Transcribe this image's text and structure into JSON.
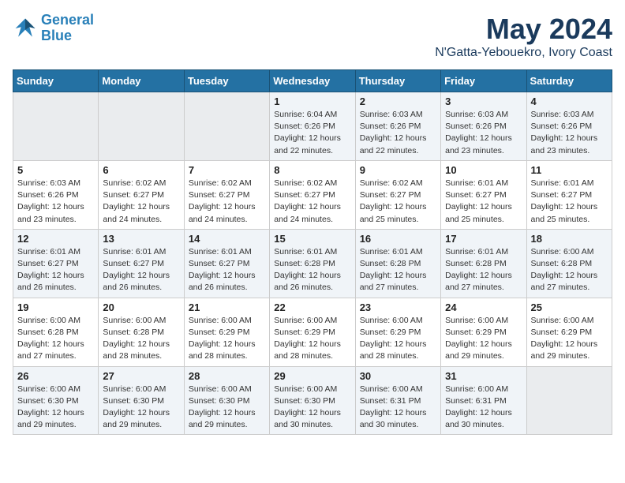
{
  "logo": {
    "line1": "General",
    "line2": "Blue"
  },
  "title": "May 2024",
  "subtitle": "N'Gatta-Yebouekro, Ivory Coast",
  "weekdays": [
    "Sunday",
    "Monday",
    "Tuesday",
    "Wednesday",
    "Thursday",
    "Friday",
    "Saturday"
  ],
  "weeks": [
    [
      {
        "day": "",
        "info": ""
      },
      {
        "day": "",
        "info": ""
      },
      {
        "day": "",
        "info": ""
      },
      {
        "day": "1",
        "info": "Sunrise: 6:04 AM\nSunset: 6:26 PM\nDaylight: 12 hours\nand 22 minutes."
      },
      {
        "day": "2",
        "info": "Sunrise: 6:03 AM\nSunset: 6:26 PM\nDaylight: 12 hours\nand 22 minutes."
      },
      {
        "day": "3",
        "info": "Sunrise: 6:03 AM\nSunset: 6:26 PM\nDaylight: 12 hours\nand 23 minutes."
      },
      {
        "day": "4",
        "info": "Sunrise: 6:03 AM\nSunset: 6:26 PM\nDaylight: 12 hours\nand 23 minutes."
      }
    ],
    [
      {
        "day": "5",
        "info": "Sunrise: 6:03 AM\nSunset: 6:26 PM\nDaylight: 12 hours\nand 23 minutes."
      },
      {
        "day": "6",
        "info": "Sunrise: 6:02 AM\nSunset: 6:27 PM\nDaylight: 12 hours\nand 24 minutes."
      },
      {
        "day": "7",
        "info": "Sunrise: 6:02 AM\nSunset: 6:27 PM\nDaylight: 12 hours\nand 24 minutes."
      },
      {
        "day": "8",
        "info": "Sunrise: 6:02 AM\nSunset: 6:27 PM\nDaylight: 12 hours\nand 24 minutes."
      },
      {
        "day": "9",
        "info": "Sunrise: 6:02 AM\nSunset: 6:27 PM\nDaylight: 12 hours\nand 25 minutes."
      },
      {
        "day": "10",
        "info": "Sunrise: 6:01 AM\nSunset: 6:27 PM\nDaylight: 12 hours\nand 25 minutes."
      },
      {
        "day": "11",
        "info": "Sunrise: 6:01 AM\nSunset: 6:27 PM\nDaylight: 12 hours\nand 25 minutes."
      }
    ],
    [
      {
        "day": "12",
        "info": "Sunrise: 6:01 AM\nSunset: 6:27 PM\nDaylight: 12 hours\nand 26 minutes."
      },
      {
        "day": "13",
        "info": "Sunrise: 6:01 AM\nSunset: 6:27 PM\nDaylight: 12 hours\nand 26 minutes."
      },
      {
        "day": "14",
        "info": "Sunrise: 6:01 AM\nSunset: 6:27 PM\nDaylight: 12 hours\nand 26 minutes."
      },
      {
        "day": "15",
        "info": "Sunrise: 6:01 AM\nSunset: 6:28 PM\nDaylight: 12 hours\nand 26 minutes."
      },
      {
        "day": "16",
        "info": "Sunrise: 6:01 AM\nSunset: 6:28 PM\nDaylight: 12 hours\nand 27 minutes."
      },
      {
        "day": "17",
        "info": "Sunrise: 6:01 AM\nSunset: 6:28 PM\nDaylight: 12 hours\nand 27 minutes."
      },
      {
        "day": "18",
        "info": "Sunrise: 6:00 AM\nSunset: 6:28 PM\nDaylight: 12 hours\nand 27 minutes."
      }
    ],
    [
      {
        "day": "19",
        "info": "Sunrise: 6:00 AM\nSunset: 6:28 PM\nDaylight: 12 hours\nand 27 minutes."
      },
      {
        "day": "20",
        "info": "Sunrise: 6:00 AM\nSunset: 6:28 PM\nDaylight: 12 hours\nand 28 minutes."
      },
      {
        "day": "21",
        "info": "Sunrise: 6:00 AM\nSunset: 6:29 PM\nDaylight: 12 hours\nand 28 minutes."
      },
      {
        "day": "22",
        "info": "Sunrise: 6:00 AM\nSunset: 6:29 PM\nDaylight: 12 hours\nand 28 minutes."
      },
      {
        "day": "23",
        "info": "Sunrise: 6:00 AM\nSunset: 6:29 PM\nDaylight: 12 hours\nand 28 minutes."
      },
      {
        "day": "24",
        "info": "Sunrise: 6:00 AM\nSunset: 6:29 PM\nDaylight: 12 hours\nand 29 minutes."
      },
      {
        "day": "25",
        "info": "Sunrise: 6:00 AM\nSunset: 6:29 PM\nDaylight: 12 hours\nand 29 minutes."
      }
    ],
    [
      {
        "day": "26",
        "info": "Sunrise: 6:00 AM\nSunset: 6:30 PM\nDaylight: 12 hours\nand 29 minutes."
      },
      {
        "day": "27",
        "info": "Sunrise: 6:00 AM\nSunset: 6:30 PM\nDaylight: 12 hours\nand 29 minutes."
      },
      {
        "day": "28",
        "info": "Sunrise: 6:00 AM\nSunset: 6:30 PM\nDaylight: 12 hours\nand 29 minutes."
      },
      {
        "day": "29",
        "info": "Sunrise: 6:00 AM\nSunset: 6:30 PM\nDaylight: 12 hours\nand 30 minutes."
      },
      {
        "day": "30",
        "info": "Sunrise: 6:00 AM\nSunset: 6:31 PM\nDaylight: 12 hours\nand 30 minutes."
      },
      {
        "day": "31",
        "info": "Sunrise: 6:00 AM\nSunset: 6:31 PM\nDaylight: 12 hours\nand 30 minutes."
      },
      {
        "day": "",
        "info": ""
      }
    ]
  ]
}
